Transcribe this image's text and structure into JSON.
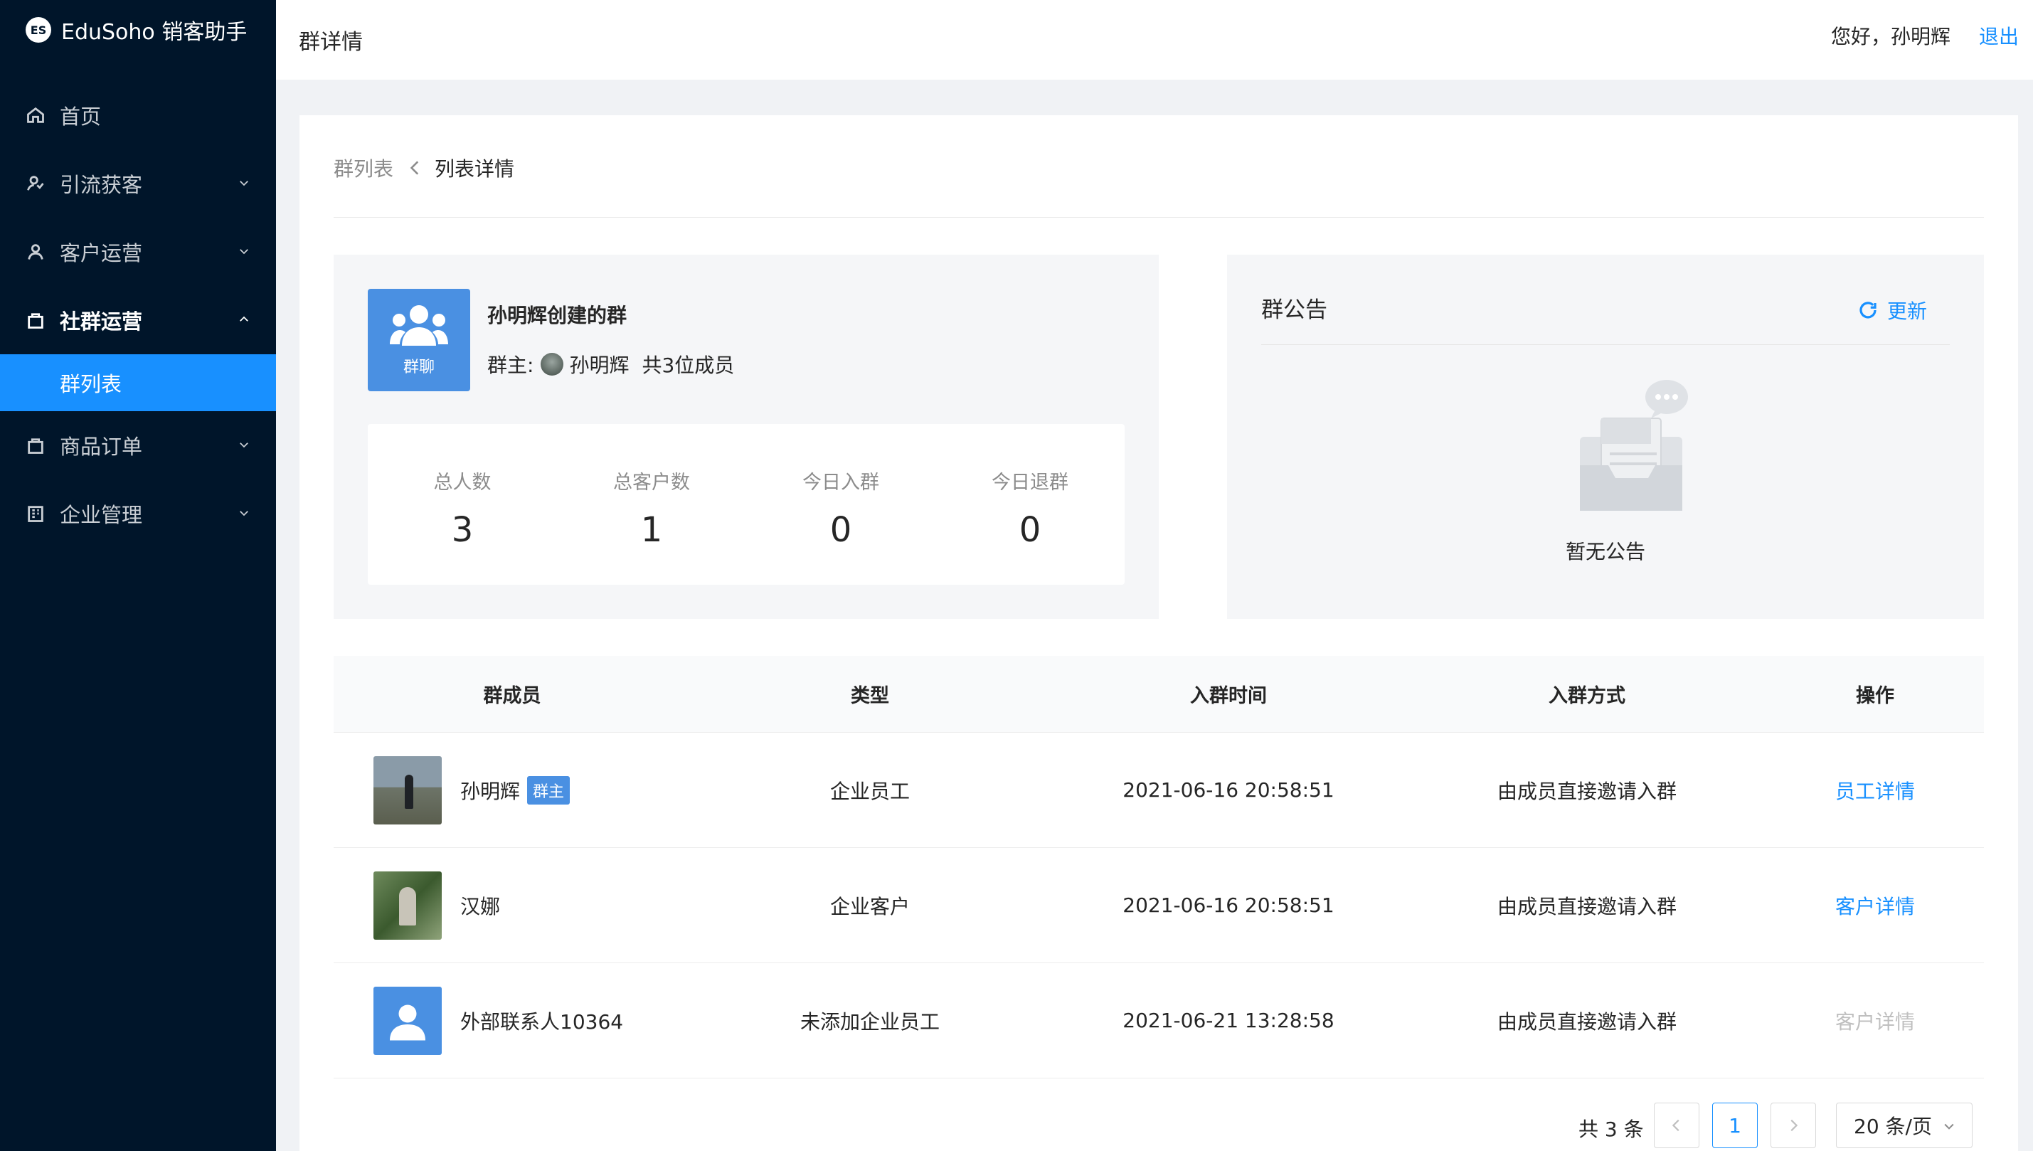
{
  "app": {
    "title": "EduSoho 销客助手",
    "logo_text": "ES"
  },
  "sidebar": {
    "items": [
      {
        "label": "首页",
        "icon": "home-icon"
      },
      {
        "label": "引流获客",
        "icon": "users-icon"
      },
      {
        "label": "客户运营",
        "icon": "user-icon"
      },
      {
        "label": "社群运营",
        "icon": "bag-icon",
        "expanded": true
      },
      {
        "label": "商品订单",
        "icon": "bag-icon"
      },
      {
        "label": "企业管理",
        "icon": "building-icon"
      }
    ],
    "sub_item": {
      "label": "群列表",
      "active": true
    }
  },
  "header": {
    "title": "群详情",
    "greeting": "您好，孙明辉",
    "logout": "退出"
  },
  "breadcrumb": {
    "parent": "群列表",
    "current": "列表详情"
  },
  "group": {
    "icon_label": "群聊",
    "name": "孙明辉创建的群",
    "owner_label": "群主:",
    "owner_name": "孙明辉",
    "member_count_text": "共3位成员"
  },
  "stats": [
    {
      "label": "总人数",
      "value": "3"
    },
    {
      "label": "总客户数",
      "value": "1"
    },
    {
      "label": "今日入群",
      "value": "0"
    },
    {
      "label": "今日退群",
      "value": "0"
    }
  ],
  "notice": {
    "title": "群公告",
    "refresh": "更新",
    "empty": "暂无公告"
  },
  "table": {
    "columns": [
      "群成员",
      "类型",
      "入群时间",
      "入群方式",
      "操作"
    ],
    "rows": [
      {
        "name": "孙明辉",
        "badge": "群主",
        "type": "企业员工",
        "time": "2021-06-16 20:58:51",
        "method": "由成员直接邀请入群",
        "action": "员工详情"
      },
      {
        "name": "汉娜",
        "badge": "",
        "type": "企业客户",
        "time": "2021-06-16 20:58:51",
        "method": "由成员直接邀请入群",
        "action": "客户详情"
      },
      {
        "name": "外部联系人10364",
        "badge": "",
        "type": "未添加企业员工",
        "time": "2021-06-21 13:28:58",
        "method": "由成员直接邀请入群",
        "action": "客户详情"
      }
    ]
  },
  "pagination": {
    "total": "共 3 条",
    "current": "1",
    "page_size": "20 条/页"
  },
  "colors": {
    "primary": "#1890ff",
    "sidebar_bg": "#00152a",
    "group_icon": "#4a90e2"
  }
}
